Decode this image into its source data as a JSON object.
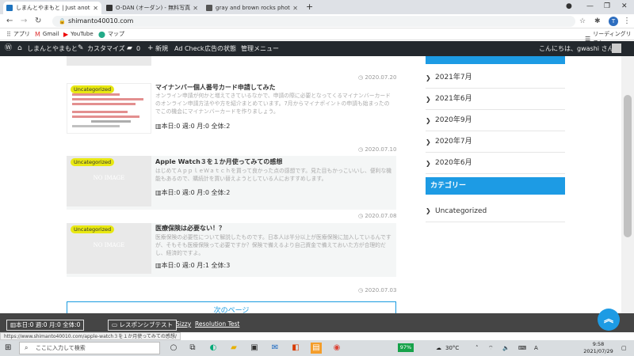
{
  "browser": {
    "tabs": [
      {
        "title": "しまんとやまもと | Just another Wo...",
        "color": "#1e73be",
        "active": true
      },
      {
        "title": "O-DAN (オーダン) - 無料写真素材...",
        "color": "#333333",
        "active": false
      },
      {
        "title": "gray and brown rocks photo – Fr...",
        "color": "#555555",
        "active": false
      }
    ],
    "url": "shimanto40010.com",
    "avatar_letter": "T",
    "bookmarks": [
      {
        "label": "アプリ",
        "icon": "apps-grid-icon"
      },
      {
        "label": "Gmail",
        "icon": "gmail-icon"
      },
      {
        "label": "YouTube",
        "icon": "youtube-icon"
      },
      {
        "label": "マップ",
        "icon": "maps-icon"
      }
    ],
    "reading_list": "リーディングリスト"
  },
  "wpbar": {
    "site_name": "しまんとやまもと",
    "customize": "カスタマイズ",
    "comments_count": "0",
    "new": "新規",
    "ad_check": "Ad Check",
    "ad_status": "広告の状態",
    "admin_menu": "管理メニュー",
    "greeting": "こんにちは、gwashi さん"
  },
  "posts": [
    {
      "date": "2020.07.20",
      "category": "Uncategorized",
      "title": "マイナンバー個人番号カード申請してみた",
      "excerpt": "オンライン申請が何かと増えてきているなかで、申請の際に必要となってくるマイナンバーカードのオンライン申請方法やや方を紹介まとめています。7月からマイナポイントの申請も始まったのでこの機会にマイナンバーカードを作りましょう。",
      "stats": "本日:0 週:0 月:0 全体:2",
      "has_image": true
    },
    {
      "date": "2020.07.10",
      "category": "Uncategorized",
      "title": "Apple Watch３を１か月使ってみての感想",
      "excerpt": "はじめてＡｐｐｌｅＷａｔｃｈを買って良かった点の感想です。見た目もかっこいいし、便利な機能もあるので、購続計を買い替えようとしている人におすすめします。",
      "stats": "本日:0 週:0 月:0 全体:2",
      "has_image": false,
      "no_image_text": "NO IMAGE"
    },
    {
      "date": "2020.07.08",
      "category": "Uncategorized",
      "title": "医療保険は必要ない！？",
      "excerpt": "医療保険の必要性について解説したものです。日本人は半分以上が医療保険に加入しているんですが、そもそも医療保険って必要ですか？保険で備えるより自己資金で備えておいた方が合理的だし、経済的ですよ。",
      "stats": "本日:0 週:0 月:1 全体:3",
      "has_image": false,
      "no_image_text": "NO IMAGE"
    }
  ],
  "last_date": "2020.07.03",
  "next_page": "次のページ",
  "sidebar": {
    "archives": [
      "2021年7月",
      "2021年6月",
      "2020年9月",
      "2020年7月",
      "2020年6月"
    ],
    "category_header": "カテゴリー",
    "categories": [
      "Uncategorized"
    ]
  },
  "debugbar": {
    "stats": "本日:0 週:0 月:0 全体:0",
    "responsive_test": "レスポンシブテスト",
    "sizzy": "Sizzy",
    "resolution_test": "Resolution Test"
  },
  "status_url": "https://www.shimanto40010.com/apple-watch３を１か月使ってみての感想/",
  "taskbar": {
    "search_placeholder": "ここに入力して検索",
    "battery": "97%",
    "temperature": "30°C",
    "time": "9:58",
    "date": "2021/07/29"
  },
  "colors": {
    "accent": "#1d9be4",
    "badge": "#e8e812",
    "wpbar": "#23282d"
  }
}
